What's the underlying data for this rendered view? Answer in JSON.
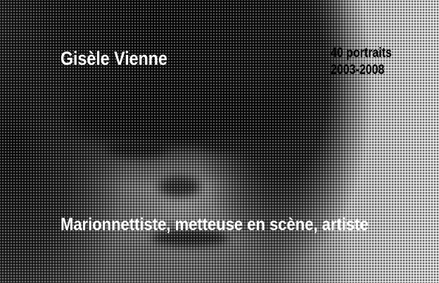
{
  "cover": {
    "name": "Gisèle Vienne",
    "series_line1": "40 portraits",
    "series_line2": "2003-2008",
    "subtitle": "Marionnettiste, metteuse en scène, artiste"
  },
  "colors": {
    "text_light": "#ffffff",
    "text_dark": "#000000"
  }
}
